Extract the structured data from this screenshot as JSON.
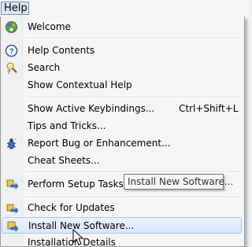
{
  "menubar": {
    "help_label": "Help"
  },
  "menu": {
    "welcome": "Welcome",
    "help_contents": "Help Contents",
    "search": "Search",
    "show_contextual_help": "Show Contextual Help",
    "show_active_keybindings": "Show Active Keybindings...",
    "show_active_keybindings_shortcut": "Ctrl+Shift+L",
    "tips_and_tricks": "Tips and Tricks...",
    "report_bug": "Report Bug or Enhancement...",
    "cheat_sheets": "Cheat Sheets...",
    "perform_setup_tasks": "Perform Setup Tasks...",
    "check_for_updates": "Check for Updates",
    "install_new_software": "Install New Software...",
    "installation_details": "Installation Details"
  },
  "tooltip": {
    "text": "Install New Software..."
  },
  "icons": {
    "welcome": "welcome-icon",
    "help_contents": "help-contents-icon",
    "search": "search-help-icon",
    "report_bug": "report-bug-icon",
    "perform_setup_tasks": "setup-tasks-icon",
    "check_for_updates": "check-updates-icon",
    "install_new_software": "install-software-icon"
  },
  "colors": {
    "highlight": "#d9e8fa",
    "highlight_border": "#a9c6ee",
    "menu_bg": "#f5f5f5"
  }
}
